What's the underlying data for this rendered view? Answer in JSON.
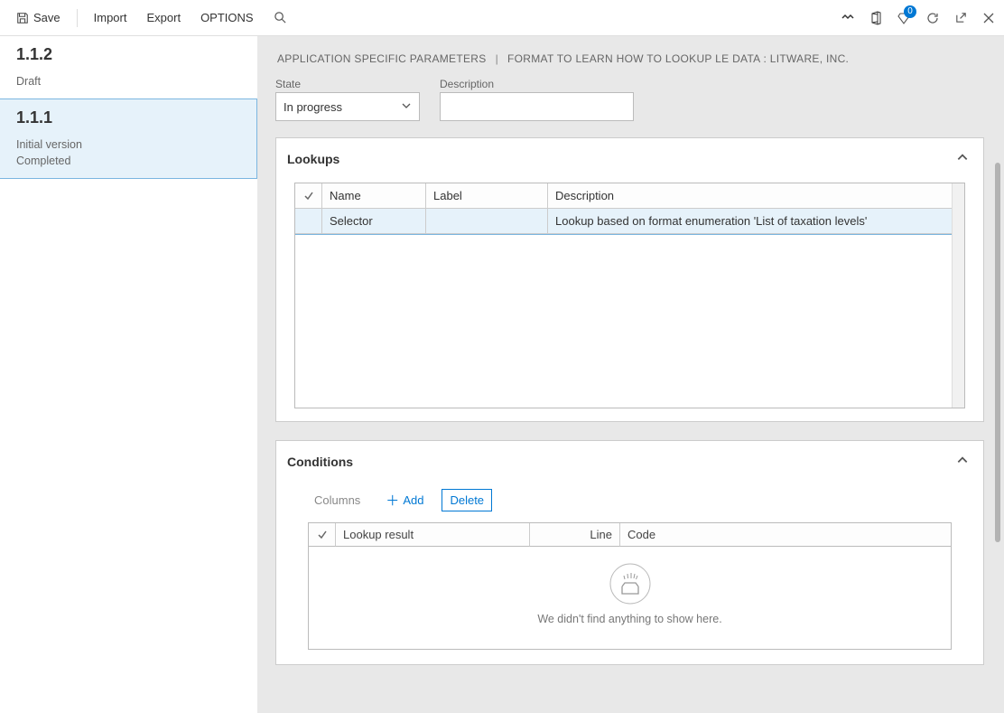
{
  "toolbar": {
    "save": "Save",
    "import": "Import",
    "export": "Export",
    "options": "OPTIONS",
    "badgeCount": "0"
  },
  "sidebar": {
    "versions": [
      {
        "num": "1.1.2",
        "lines": [
          "Draft"
        ]
      },
      {
        "num": "1.1.1",
        "lines": [
          "Initial version",
          "Completed"
        ]
      }
    ]
  },
  "breadcrumb": {
    "left": "APPLICATION SPECIFIC PARAMETERS",
    "right": "FORMAT TO LEARN HOW TO LOOKUP LE DATA : LITWARE, INC."
  },
  "fields": {
    "stateLabel": "State",
    "stateValue": "In progress",
    "descLabel": "Description",
    "descValue": ""
  },
  "lookups": {
    "title": "Lookups",
    "headers": {
      "name": "Name",
      "label": "Label",
      "desc": "Description"
    },
    "rows": [
      {
        "name": "Selector",
        "label": "",
        "desc": "Lookup based on format enumeration 'List of taxation levels'"
      }
    ]
  },
  "conditions": {
    "title": "Conditions",
    "columns": "Columns",
    "add": "Add",
    "delete": "Delete",
    "headers": {
      "lookup": "Lookup result",
      "line": "Line",
      "code": "Code"
    },
    "emptyMessage": "We didn't find anything to show here."
  }
}
